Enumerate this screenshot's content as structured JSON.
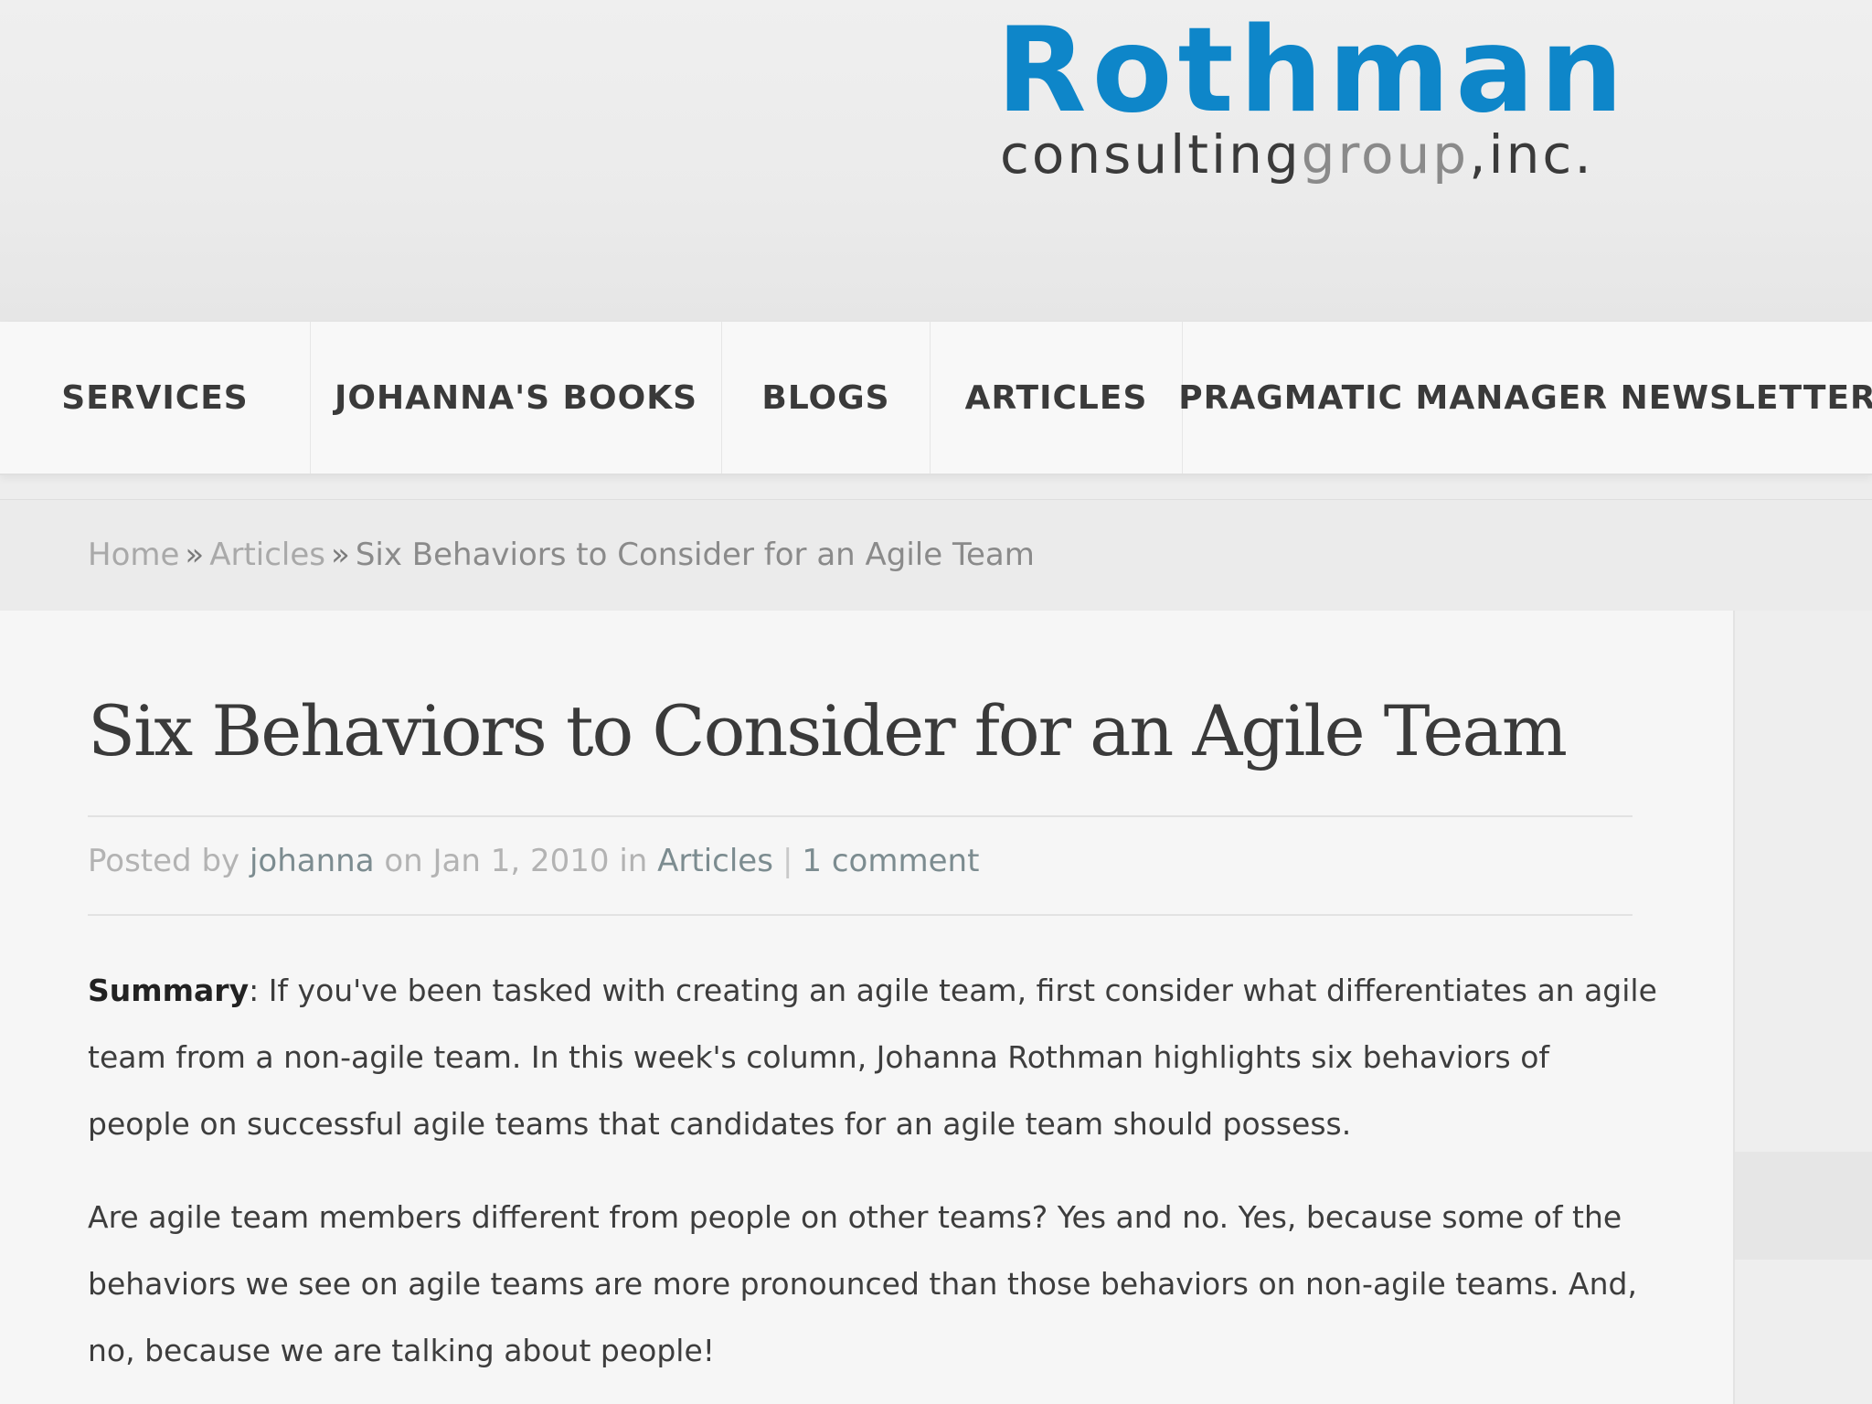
{
  "logo": {
    "main": "Rothman",
    "sub_a": "consulting",
    "sub_b": "group",
    "sub_c": ",inc."
  },
  "nav": {
    "items": [
      {
        "label": "SERVICES"
      },
      {
        "label": "JOHANNA'S BOOKS"
      },
      {
        "label": "BLOGS"
      },
      {
        "label": "ARTICLES"
      },
      {
        "label": "PRAGMATIC MANAGER NEWSLETTER"
      }
    ]
  },
  "breadcrumb": {
    "home": "Home",
    "separator": "»",
    "section": "Articles",
    "current": "Six Behaviors to Consider for an Agile Team"
  },
  "article": {
    "title": "Six Behaviors to Consider for an Agile Team",
    "meta": {
      "posted_by": "Posted by",
      "author": "johanna",
      "on": "on",
      "date": "Jan 1, 2010",
      "in": "in",
      "category": "Articles",
      "pipe": "|",
      "comments": "1 comment"
    },
    "summary_label": "Summary",
    "summary_text": ": If you've been tasked with creating an agile team, first consider what differentiates an agile team from a non-agile team. In this week's column, Johanna Rothman highlights six behaviors of people on successful agile teams that candidates for an agile team should possess.",
    "paragraph_2": "Are agile team members different from people on other teams? Yes and no. Yes, because some of the behaviors we see on agile teams are more pronounced than those behaviors on non-agile teams. And, no, because we are talking about people!"
  },
  "colors": {
    "brand_blue": "#0e86c9",
    "link_gray": "#7c8c90",
    "text": "#3d3d3d"
  }
}
